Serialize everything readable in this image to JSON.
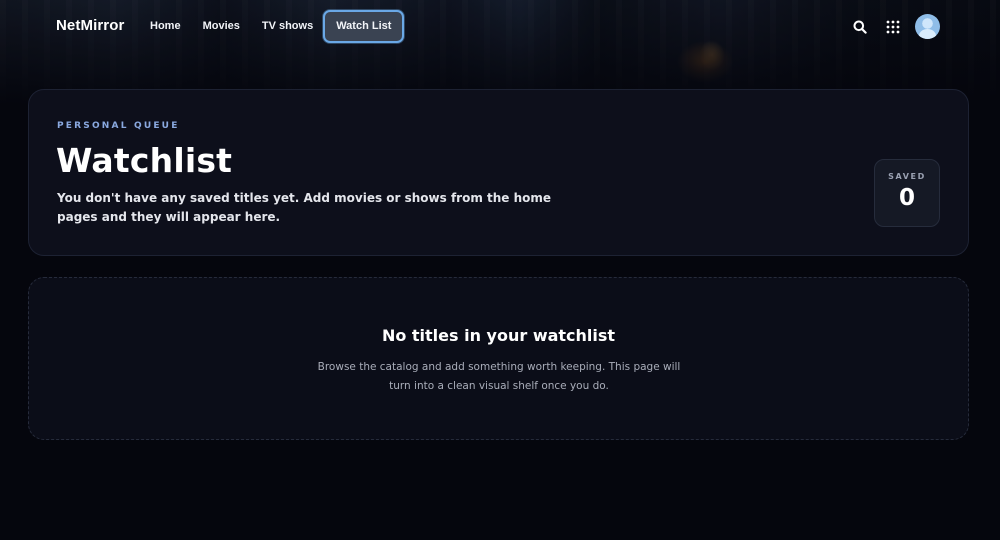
{
  "nav": {
    "brand": "NetMirror",
    "links": [
      {
        "label": "Home"
      },
      {
        "label": "Movies"
      },
      {
        "label": "TV shows"
      },
      {
        "label": "Watch List",
        "active": true
      }
    ],
    "icons": [
      "search-icon",
      "apps-grid-icon",
      "avatar"
    ]
  },
  "hero": {
    "eyebrow": "PERSONAL QUEUE",
    "title": "Watchlist",
    "description": "You don't have any saved titles yet. Add movies or shows from the home pages and they will appear here.",
    "stat": {
      "label": "SAVED",
      "value": "0"
    }
  },
  "empty_state": {
    "title": "No titles in your watchlist",
    "description": "Browse the catalog and add something worth keeping. This page will turn into a clean visual shelf once you do."
  },
  "colors": {
    "background": "#05060d",
    "accent": "#6aa8e6",
    "eyebrow": "#8aa9e0"
  }
}
